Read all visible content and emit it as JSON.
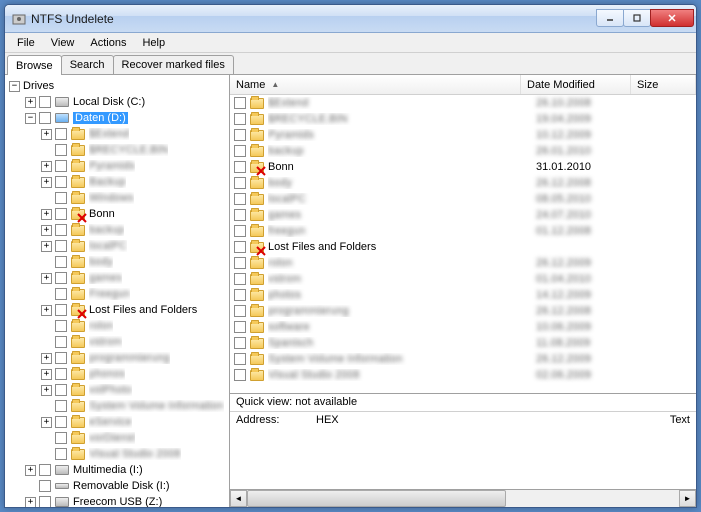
{
  "window": {
    "title": "NTFS Undelete"
  },
  "menu": {
    "file": "File",
    "view": "View",
    "actions": "Actions",
    "help": "Help"
  },
  "tabs": {
    "browse": "Browse",
    "search": "Search",
    "recover": "Recover marked files"
  },
  "tree": {
    "root": "Drives",
    "local_disk": "Local Disk (C:)",
    "daten": "Daten (D:)",
    "bonn": "Bonn",
    "lost": "Lost Files and Folders",
    "multimedia": "Multimedia (I:)",
    "removable": "Removable Disk (I:)",
    "freecom": "Freecom USB (Z:)",
    "blur_items": [
      "$Extend",
      "$RECYCLE.BIN",
      "Pyramids",
      "Backup",
      "Windows",
      "backup",
      "localPC",
      "body",
      "games",
      "Freegun",
      "rolon",
      "vstrom",
      "programmierung",
      "phonos",
      "volPhoto",
      "System Volume Information",
      "eService",
      "vorDienst",
      "Visual Studio 2008"
    ]
  },
  "list": {
    "headers": {
      "name": "Name",
      "date": "Date Modified",
      "size": "Size"
    },
    "bonn": "Bonn",
    "bonn_date": "31.01.2010",
    "lost": "Lost Files and Folders",
    "blur_items": [
      {
        "n": "$Extend",
        "d": "26.10.2008"
      },
      {
        "n": "$RECYCLE.BIN",
        "d": "19.04.2009"
      },
      {
        "n": "Pyramids",
        "d": "10.12.2009"
      },
      {
        "n": "backup",
        "d": "26.01.2010"
      },
      {
        "n": "body",
        "d": "26.12.2008"
      },
      {
        "n": "localPC",
        "d": "08.05.2010"
      },
      {
        "n": "games",
        "d": "24.07.2010"
      },
      {
        "n": "freegun",
        "d": "01.12.2008"
      },
      {
        "n": "rolon",
        "d": "26.12.2009"
      },
      {
        "n": "vstrom",
        "d": "01.04.2010"
      },
      {
        "n": "photos",
        "d": "14.12.2009"
      },
      {
        "n": "programmierung",
        "d": "26.12.2008"
      },
      {
        "n": "software",
        "d": "10.06.2009"
      },
      {
        "n": "Spanisch",
        "d": "11.08.2009"
      },
      {
        "n": "System Volume Information",
        "d": "26.12.2009"
      },
      {
        "n": "Visual Studio 2008",
        "d": "02.06.2009"
      }
    ]
  },
  "quickview": {
    "text": "Quick view:  not available",
    "address": "Address:",
    "hex": "HEX",
    "txt": "Text"
  }
}
